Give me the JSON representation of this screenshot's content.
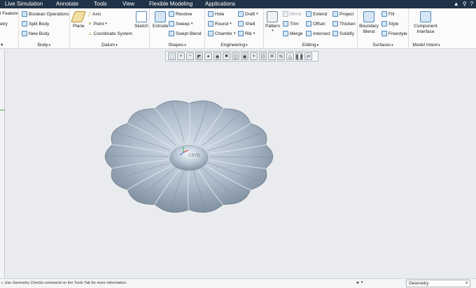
{
  "menu_tabs": [
    "Live Simulation",
    "Annotate",
    "Tools",
    "View",
    "Flexible Modeling",
    "Applications"
  ],
  "top_icons": [
    "▲",
    "⚲",
    "?"
  ],
  "ribbon": {
    "partial_feature": "l Feature",
    "partial_etry": "etry",
    "body": {
      "boolean": "Boolean Operations",
      "split": "Split Body",
      "new": "New Body",
      "label": "Body"
    },
    "datum": {
      "plane": "Plane",
      "axis": "Axis",
      "point": "Point",
      "coord": "Coordinate System",
      "sketch": "Sketch",
      "label": "Datum"
    },
    "shapes": {
      "extrude": "Extrude",
      "revolve": "Revolve",
      "sweep": "Sweep",
      "swept_blend": "Swept Blend",
      "label": "Shapes"
    },
    "engineering": {
      "hole": "Hole",
      "round": "Round",
      "chamfer": "Chamfer",
      "draft": "Draft",
      "shell": "Shell",
      "rib": "Rib",
      "label": "Engineering"
    },
    "editing": {
      "pattern": "Pattern",
      "mirror": "Mirror",
      "trim": "Trim",
      "merge": "Merge",
      "extend": "Extend",
      "offset": "Offset",
      "intersect": "Intersect",
      "project": "Project",
      "thicken": "Thicken",
      "solidify": "Solidify",
      "label": "Editing"
    },
    "surfaces": {
      "boundary": "Boundary Blend",
      "fill": "Fill",
      "style": "Style",
      "freestyle": "Freestyle",
      "label": "Surfaces"
    },
    "model_intent": {
      "component": "Component Interface",
      "label": "Model Intent"
    }
  },
  "view_toolbar_icons": [
    "refit-icon",
    "zoom-in-icon",
    "zoom-out-icon",
    "repaint-icon",
    "spin-center-icon",
    "appearance-icon",
    "display-style-icon",
    "saved-views-icon",
    "view-manager-icon",
    "datum-display-icon",
    "annotation-display-icon",
    "section-icon",
    "transform-icon",
    "perspective-icon",
    "pause-icon",
    "flip-icon"
  ],
  "status": {
    "message": "r. Use Geometry Checks command on the Tools Tab for more information.",
    "filter": "Geometry"
  },
  "model": {
    "color": "#a9b7c6",
    "label": "CSYS"
  }
}
